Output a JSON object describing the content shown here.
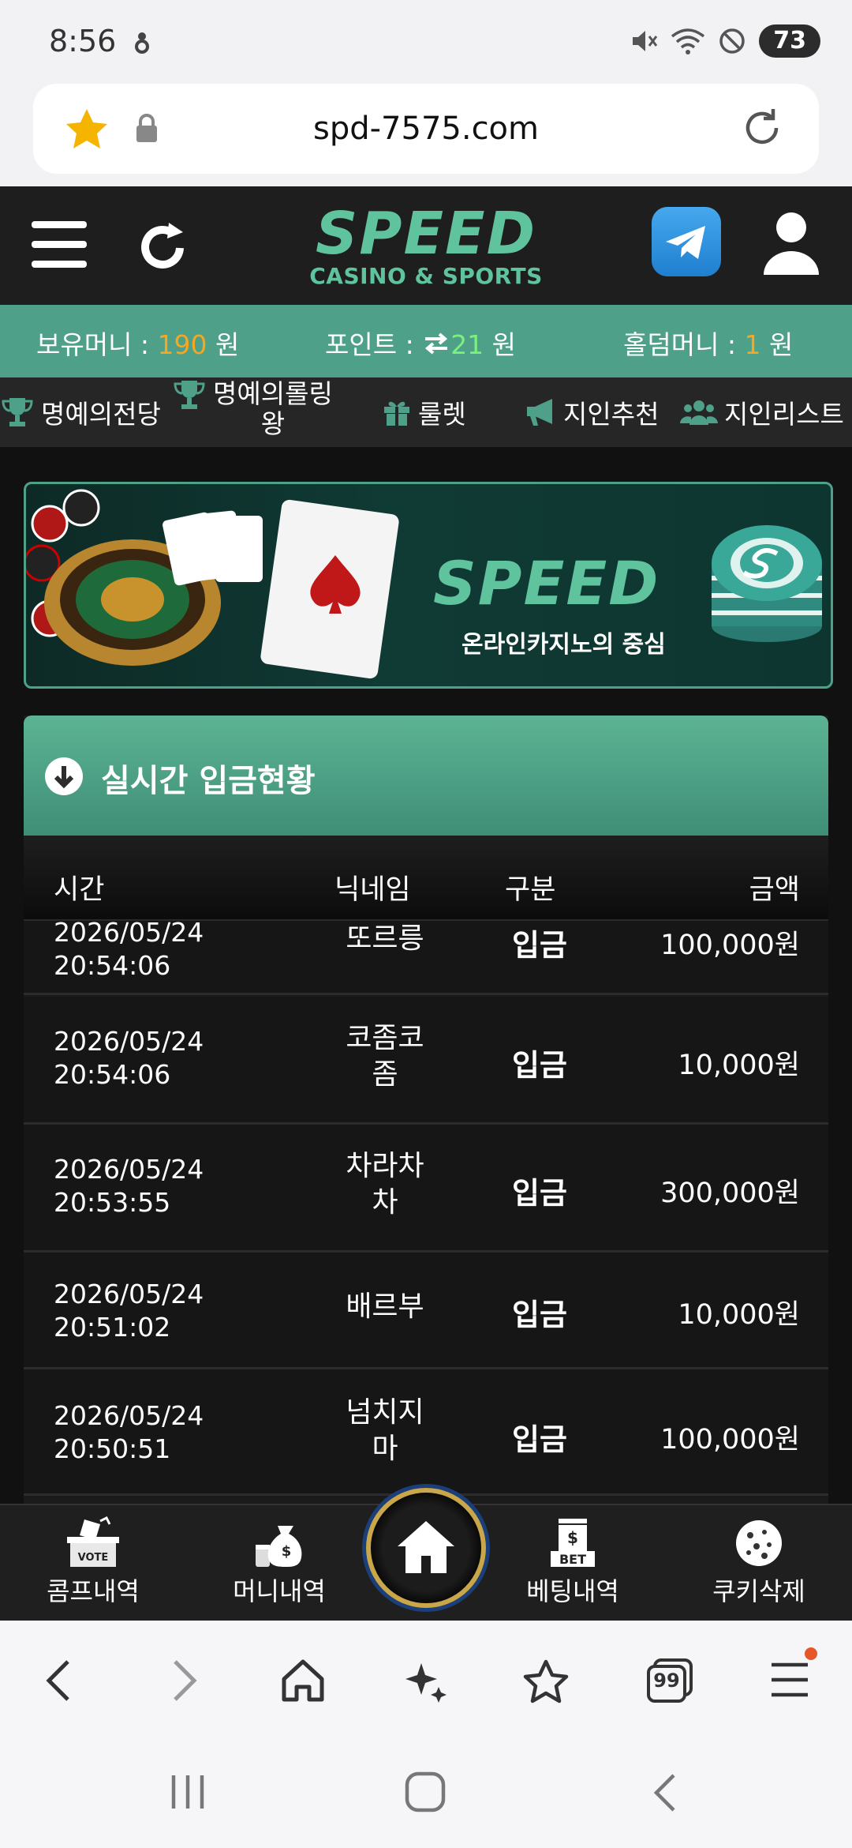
{
  "status_bar": {
    "time": "8:56",
    "battery": "73"
  },
  "browser": {
    "url": "spd-7575.com"
  },
  "header": {
    "logo_main": "SPEED",
    "logo_sub": "CASINO & SPORTS"
  },
  "balance": {
    "money_label": "보유머니 : ",
    "money_value": "190",
    "money_unit": " 원",
    "point_label": "포인트 : ",
    "point_value": "21",
    "point_unit": " 원",
    "holdem_label": "홀덤머니 : ",
    "holdem_value": "1",
    "holdem_unit": " 원"
  },
  "menu": {
    "hall_of_fame": "명예의전당",
    "rolling_king_1": "명예의롤링",
    "rolling_king_2": "왕",
    "roulette": "룰렛",
    "referral": "지인추천",
    "referral_list": "지인리스트"
  },
  "banner": {
    "logo": "SPEED",
    "tagline": "온라인카지노의 중심"
  },
  "deposits": {
    "title": "실시간 입금현황",
    "columns": {
      "time": "시간",
      "nickname": "닉네임",
      "type": "구분",
      "amount": "금액"
    },
    "rows": [
      {
        "date": "2026/05/24",
        "time": "20:54:06",
        "nick1": "또르릉",
        "nick2": "",
        "type": "입금",
        "amount": "100,000원"
      },
      {
        "date": "2026/05/24",
        "time": "20:54:06",
        "nick1": "코좀코",
        "nick2": "좀",
        "type": "입금",
        "amount": "10,000원"
      },
      {
        "date": "2026/05/24",
        "time": "20:53:55",
        "nick1": "차라차",
        "nick2": "차",
        "type": "입금",
        "amount": "300,000원"
      },
      {
        "date": "2026/05/24",
        "time": "20:51:02",
        "nick1": "배르부",
        "nick2": "",
        "type": "입금",
        "amount": "10,000원"
      },
      {
        "date": "2026/05/24",
        "time": "20:50:51",
        "nick1": "넘치지",
        "nick2": "마",
        "type": "입금",
        "amount": "100,000원"
      }
    ]
  },
  "site_nav": {
    "comp": "콤프내역",
    "money": "머니내역",
    "betting": "베팅내역",
    "cookie": "쿠키삭제",
    "vote_badge": "VOTE",
    "bet_badge": "BET"
  },
  "browser_toolbar": {
    "tabs_count": "99"
  },
  "colors": {
    "brand_green": "#5fc39d",
    "balance_bar": "#4ea088",
    "orange_value": "#f5a623",
    "green_value": "#7cf07c",
    "gold_ring": "#c9a64a"
  }
}
